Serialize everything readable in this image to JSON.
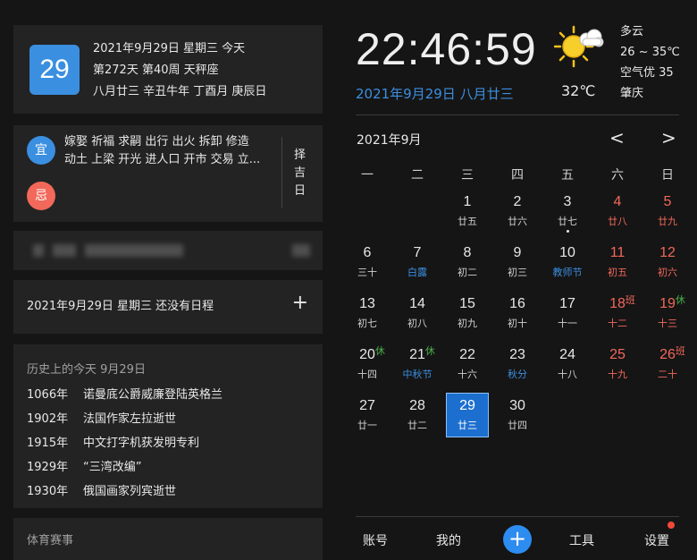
{
  "date_card": {
    "day": "29",
    "line1": "2021年9月29日 星期三 今天",
    "line2": "第272天 第40周 天秤座",
    "line3": "八月廿三 辛丑牛年 丁酉月 庚辰日"
  },
  "yiji": {
    "yi_label": "宜",
    "yi_text_1": "嫁娶 祈福 求嗣 出行 出火 拆卸 修造",
    "yi_text_2": "动土 上梁 开光 进人口 开市 交易 立...",
    "ji_label": "忌",
    "ze_ji": "择吉日",
    "colors": {
      "yi": "#3b8fe0",
      "ji": "#f2685a"
    }
  },
  "schedule": {
    "text": "2021年9月29日 星期三 还没有日程",
    "add_label": "+"
  },
  "history": {
    "title": "历史上的今天 9月29日",
    "items": [
      {
        "year": "1066年",
        "event": "诺曼底公爵威廉登陆英格兰"
      },
      {
        "year": "1902年",
        "event": "法国作家左拉逝世"
      },
      {
        "year": "1915年",
        "event": "中文打字机获发明专利"
      },
      {
        "year": "1929年",
        "event": "“三湾改编”"
      },
      {
        "year": "1930年",
        "event": "俄国画家列宾逝世"
      }
    ]
  },
  "sports": {
    "title": "体育赛事"
  },
  "clock": {
    "time": "22:46:59",
    "lunar_date": "2021年9月29日 八月廿三"
  },
  "weather": {
    "icon": "sun-cloud-icon",
    "temp_now": "32℃",
    "condition": "多云",
    "range": "26 ~ 35℃",
    "air": "空气优 35",
    "city": "肇庆"
  },
  "calendar": {
    "month_title": "2021年9月",
    "prev": "<",
    "next": ">",
    "weekdays": [
      "一",
      "二",
      "三",
      "四",
      "五",
      "六",
      "日"
    ],
    "weeks": [
      [
        null,
        null,
        {
          "num": "1",
          "sub": "廿五"
        },
        {
          "num": "2",
          "sub": "廿六"
        },
        {
          "num": "3",
          "sub": "廿七",
          "dot": true
        },
        {
          "num": "4",
          "sub": "廿八",
          "red": true
        },
        {
          "num": "5",
          "sub": "廿九",
          "red": true
        }
      ],
      [
        {
          "num": "6",
          "sub": "三十"
        },
        {
          "num": "7",
          "sub": "白露",
          "blue": true
        },
        {
          "num": "8",
          "sub": "初二"
        },
        {
          "num": "9",
          "sub": "初三"
        },
        {
          "num": "10",
          "sub": "教师节",
          "blue": true
        },
        {
          "num": "11",
          "sub": "初五",
          "red": true
        },
        {
          "num": "12",
          "sub": "初六",
          "red": true
        }
      ],
      [
        {
          "num": "13",
          "sub": "初七"
        },
        {
          "num": "14",
          "sub": "初八"
        },
        {
          "num": "15",
          "sub": "初九"
        },
        {
          "num": "16",
          "sub": "初十"
        },
        {
          "num": "17",
          "sub": "十一"
        },
        {
          "num": "18",
          "sub": "十二",
          "red": true,
          "tag": "班",
          "tag_type": "work"
        },
        {
          "num": "19",
          "sub": "十三",
          "red": true,
          "tag": "休",
          "tag_type": "rest"
        }
      ],
      [
        {
          "num": "20",
          "sub": "十四",
          "tag": "休",
          "tag_type": "rest"
        },
        {
          "num": "21",
          "sub": "中秋节",
          "blue": true,
          "tag": "休",
          "tag_type": "rest"
        },
        {
          "num": "22",
          "sub": "十六"
        },
        {
          "num": "23",
          "sub": "秋分",
          "blue": true
        },
        {
          "num": "24",
          "sub": "十八"
        },
        {
          "num": "25",
          "sub": "十九",
          "red": true
        },
        {
          "num": "26",
          "sub": "二十",
          "red": true,
          "tag": "班",
          "tag_type": "work"
        }
      ],
      [
        {
          "num": "27",
          "sub": "廿一"
        },
        {
          "num": "28",
          "sub": "廿二"
        },
        {
          "num": "29",
          "sub": "廿三",
          "selected": true
        },
        {
          "num": "30",
          "sub": "廿四"
        },
        null,
        null,
        null
      ]
    ]
  },
  "bottom_nav": {
    "account": "账号",
    "mine": "我的",
    "add": "+",
    "tools": "工具",
    "settings": "设置"
  }
}
